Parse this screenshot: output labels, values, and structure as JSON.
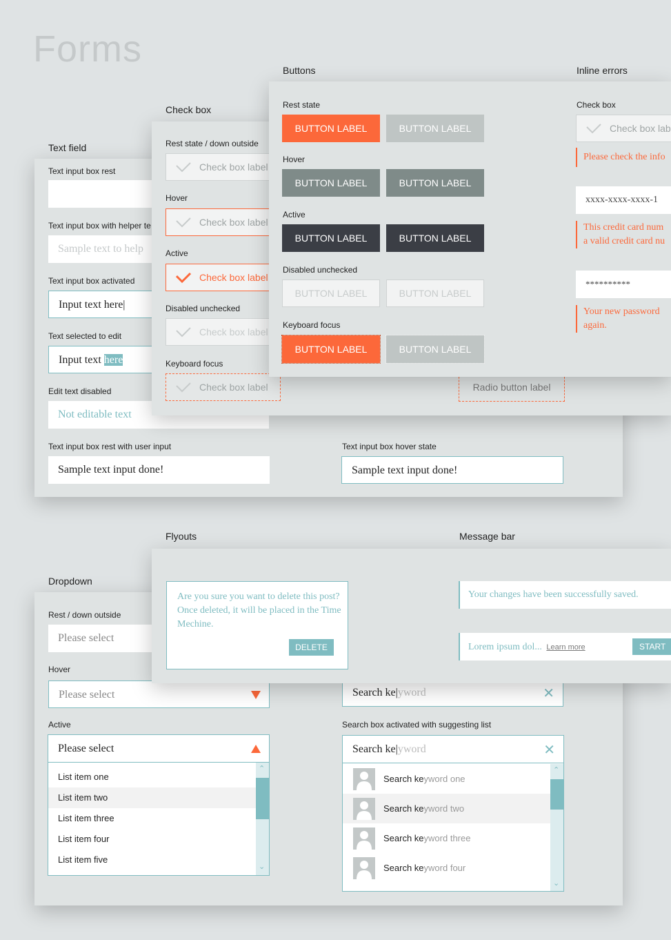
{
  "title": "Forms",
  "colors": {
    "accent": "#fc683a",
    "teal": "#7fbcc1",
    "dark": "#3b3e45",
    "hover_gray": "#7f8b89",
    "rest_gray": "#bfc5c4"
  },
  "text_field": {
    "heading": "Text field",
    "rest_label": "Text input box rest",
    "helper_label": "Text input box with helper te",
    "helper_placeholder": "Sample text to help",
    "activated_label": "Text input box activated",
    "activated_value": "Input text here",
    "selected_label": "Text selected to edit",
    "selected_value": "Input text ",
    "selected_highlight": "here",
    "disabled_label": "Edit text disabled",
    "disabled_value": "Not editable text",
    "user_input_label": "Text input box rest with user input",
    "user_input_value": "Sample text input done!",
    "hover_label": "Text input box hover state",
    "hover_value": "Sample text input done!"
  },
  "checkbox": {
    "heading": "Check box",
    "item_label": "Check box label",
    "radio_label": "Radio button label",
    "states": [
      "Rest state / down outside",
      "Hover",
      "Active",
      "Disabled unchecked",
      "Keyboard focus"
    ]
  },
  "buttons": {
    "heading": "Buttons",
    "label": "BUTTON LABEL",
    "states": [
      "Rest state",
      "Hover",
      "Active",
      "Disabled unchecked",
      "Keyboard focus"
    ]
  },
  "inline_errors": {
    "heading": "Inline errors",
    "checkbox_label": "Check box",
    "checkbox_item": "Check box lab",
    "check_error": "Please check the info",
    "card_value": "xxxx-xxxx-xxxx-1",
    "card_error_1": "This credit card num",
    "card_error_2": "a valid credit card nu",
    "password_value": "**********",
    "password_error_1": "Your new password",
    "password_error_2": "again."
  },
  "flyouts": {
    "heading": "Flyouts",
    "text": "Are you sure you want to delete this post? Once deleted, it will be placed in the Time Mechine.",
    "delete_label": "DELETE"
  },
  "message_bar": {
    "heading": "Message bar",
    "saved": "Your changes have been successfully saved.",
    "lorem": "Lorem ipsum dol...",
    "learn_more": "Learn more",
    "start_label": "START"
  },
  "dropdown": {
    "heading": "Dropdown",
    "rest_label": "Rest / down outside",
    "hover_label": "Hover",
    "active_label": "Active",
    "placeholder": "Please select",
    "items": [
      "List item one",
      "List item two",
      "List item three",
      "List item four",
      "List item five"
    ]
  },
  "search": {
    "typed": "Search ke",
    "suggest": "yword",
    "active_label": "Search box activated with suggesting list",
    "suggestions": [
      {
        "typed": "Search ke",
        "rest": "yword one"
      },
      {
        "typed": "Search ke",
        "rest": "yword two"
      },
      {
        "typed": "Search ke",
        "rest": "yword three"
      },
      {
        "typed": "Search ke",
        "rest": "yword four"
      }
    ]
  }
}
